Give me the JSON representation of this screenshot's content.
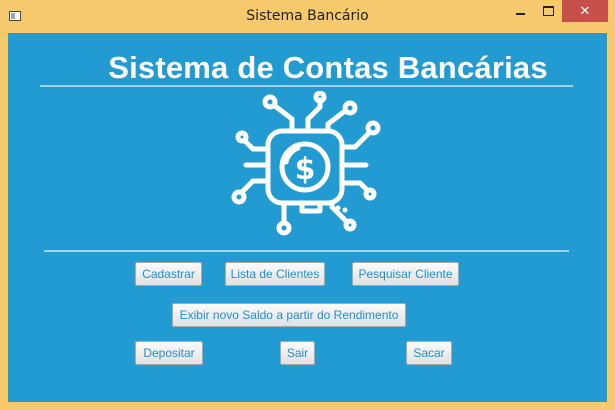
{
  "window": {
    "title": "Sistema Bancário",
    "close_glyph": "✕"
  },
  "main": {
    "heading": "Sistema de Contas Bancárias",
    "logo_icon": "circuit-dollar-icon",
    "buttons": {
      "cadastrar": "Cadastrar",
      "lista_clientes": "Lista de Clientes",
      "pesquisar_cliente": "Pesquisar Cliente",
      "exibir_saldo": "Exibir novo Saldo a partir do Rendimento",
      "depositar": "Depositar",
      "sair": "Sair",
      "sacar": "Sacar"
    }
  },
  "colors": {
    "window_frame": "#f5c96c",
    "content_bg": "#229bd2",
    "close_button": "#c7504a",
    "button_text": "#1e8fd0"
  }
}
